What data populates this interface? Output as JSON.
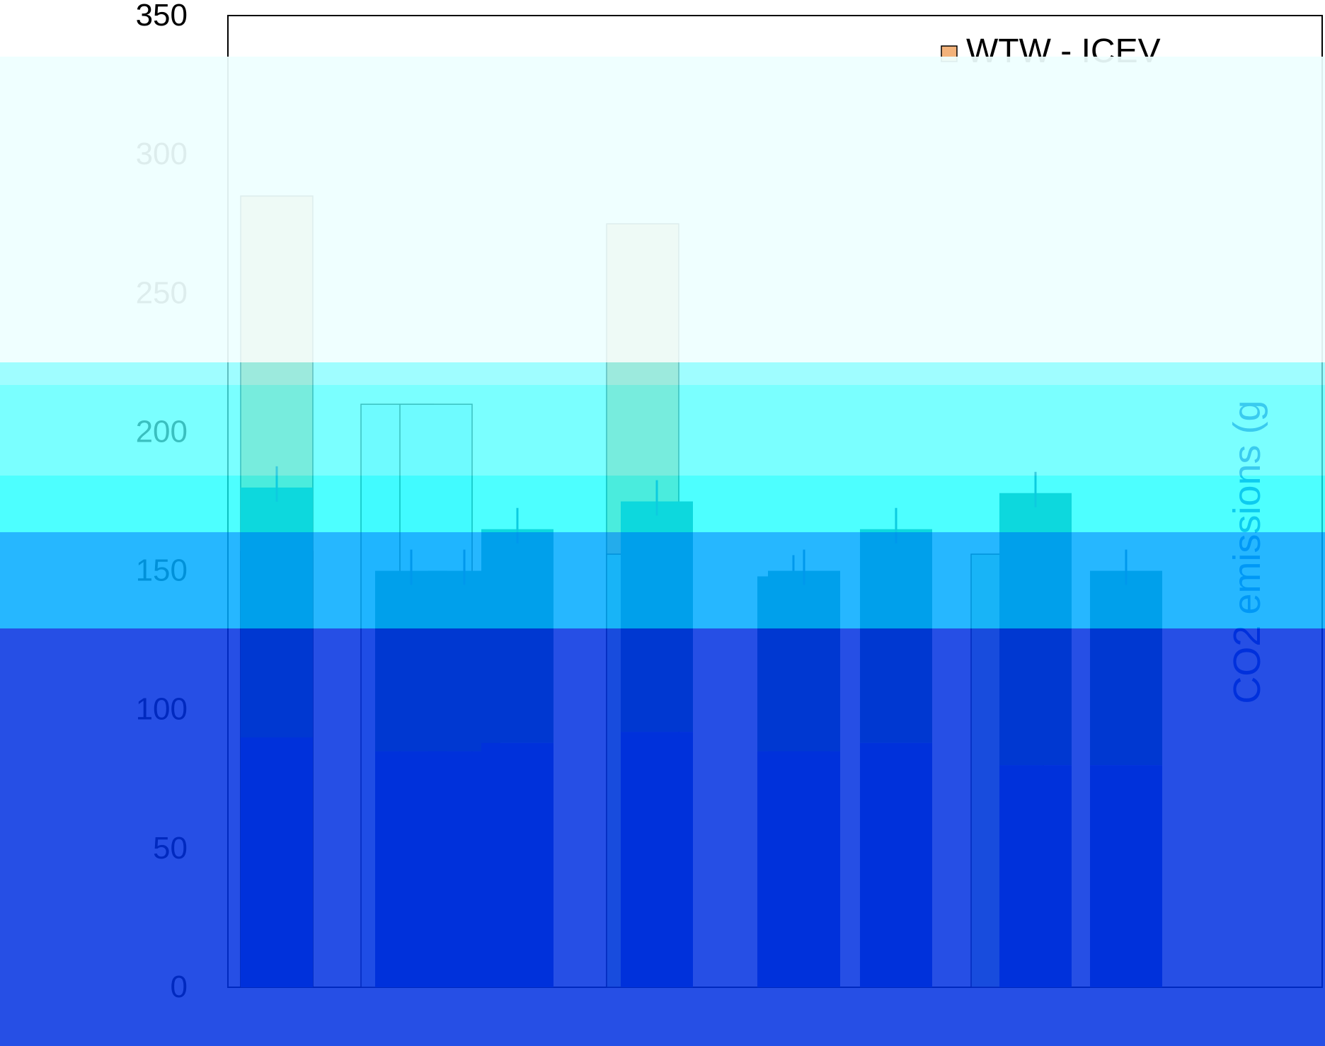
{
  "chart_data": {
    "type": "bar",
    "ylim": [
      0,
      350
    ],
    "yticks": [
      "0",
      "50",
      "100",
      "150",
      "200",
      "250",
      "300",
      "350"
    ],
    "ylabel": "CO2 emissions (g",
    "categories": [
      "",
      "",
      "",
      "",
      "",
      "",
      "",
      "",
      "",
      ""
    ],
    "series": [
      {
        "name": "WTW - ICEV",
        "values": [
          285,
          0,
          0,
          0,
          275,
          0,
          0,
          0,
          0,
          0
        ]
      },
      {
        "name": "",
        "values": [
          157,
          0,
          0,
          0,
          156,
          0,
          0,
          0,
          156,
          0
        ]
      },
      {
        "name": "",
        "values": [
          0,
          210,
          210,
          0,
          0,
          0,
          0,
          0,
          0,
          0
        ]
      },
      {
        "name": "",
        "values": [
          0,
          0,
          0,
          0,
          0,
          0,
          0,
          0,
          0,
          0
        ]
      }
    ],
    "stacks": [
      {
        "base": 90,
        "top": 180
      },
      {
        "base": 85,
        "top": 150
      },
      {
        "base": 85,
        "top": 150
      },
      {
        "base": 88,
        "top": 165
      },
      {
        "base": 92,
        "top": 175
      },
      {
        "base": 85,
        "top": 148
      },
      {
        "base": 85,
        "top": 150
      },
      {
        "base": 88,
        "top": 165
      },
      {
        "base": 80,
        "top": 178
      },
      {
        "base": 80,
        "top": 150
      }
    ],
    "legend_position": "top-right",
    "colors": {
      "icev": "#f2b27a",
      "band_light": "#eeffff",
      "band_cyan1": "#7ffcff",
      "band_cyan2": "#4dffff",
      "band_cyan3": "#12ffff",
      "band_azure": "#00aaff",
      "band_blue": "#0030e0",
      "bar_dark": "#006677",
      "bar_navy": "#0038b8"
    }
  }
}
